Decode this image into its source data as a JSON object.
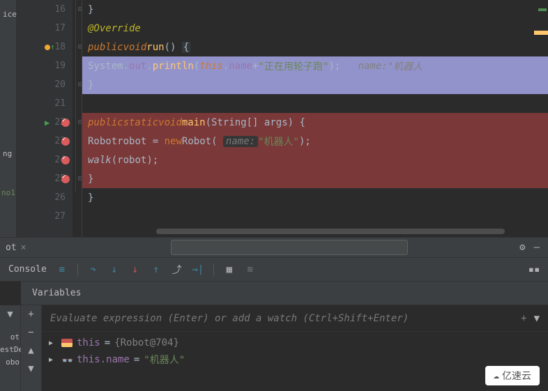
{
  "gutter": {
    "lines": [
      "16",
      "17",
      "18",
      "19",
      "20",
      "21",
      "22",
      "23",
      "24",
      "25",
      "26",
      "27"
    ]
  },
  "code": {
    "annotation": "@Override",
    "kw_public": "public",
    "kw_void": "void",
    "kw_static": "static",
    "kw_this": "this",
    "kw_new": "new",
    "method_run": "run",
    "method_main": "main",
    "method_walk": "walk",
    "class_system": "System",
    "field_out": "out",
    "method_println": "println",
    "field_name": "name",
    "str_run": "\"正在用轮子跑\"",
    "hint_name": "name:",
    "hint_name_val": "\"机器人",
    "class_string": "String",
    "param_args": "args",
    "class_robot": "Robot",
    "var_robot": "robot",
    "param_hint_name": "name:",
    "str_robot": "\"机器人\"",
    "brace_close": "}",
    "brace_open": "{",
    "paren": "()",
    "semi": ";"
  },
  "tabs": {
    "tab1": "ot",
    "close": "×"
  },
  "toolbar": {
    "console": "Console"
  },
  "vars": {
    "header": "Variables",
    "watch_placeholder": "Evaluate expression (Enter) or add a watch (Ctrl+Shift+Enter)",
    "this_name": "this",
    "this_val": "{Robot@704}",
    "name_field": "this.name",
    "name_val": "\"机器人\"",
    "eq": "="
  },
  "leftpanel": {
    "t1": "ice",
    "t2": "ng",
    "t3": "no1",
    "f1": "ot",
    "f2": "estDe",
    "f3": "obo"
  },
  "watermark": "亿速云"
}
